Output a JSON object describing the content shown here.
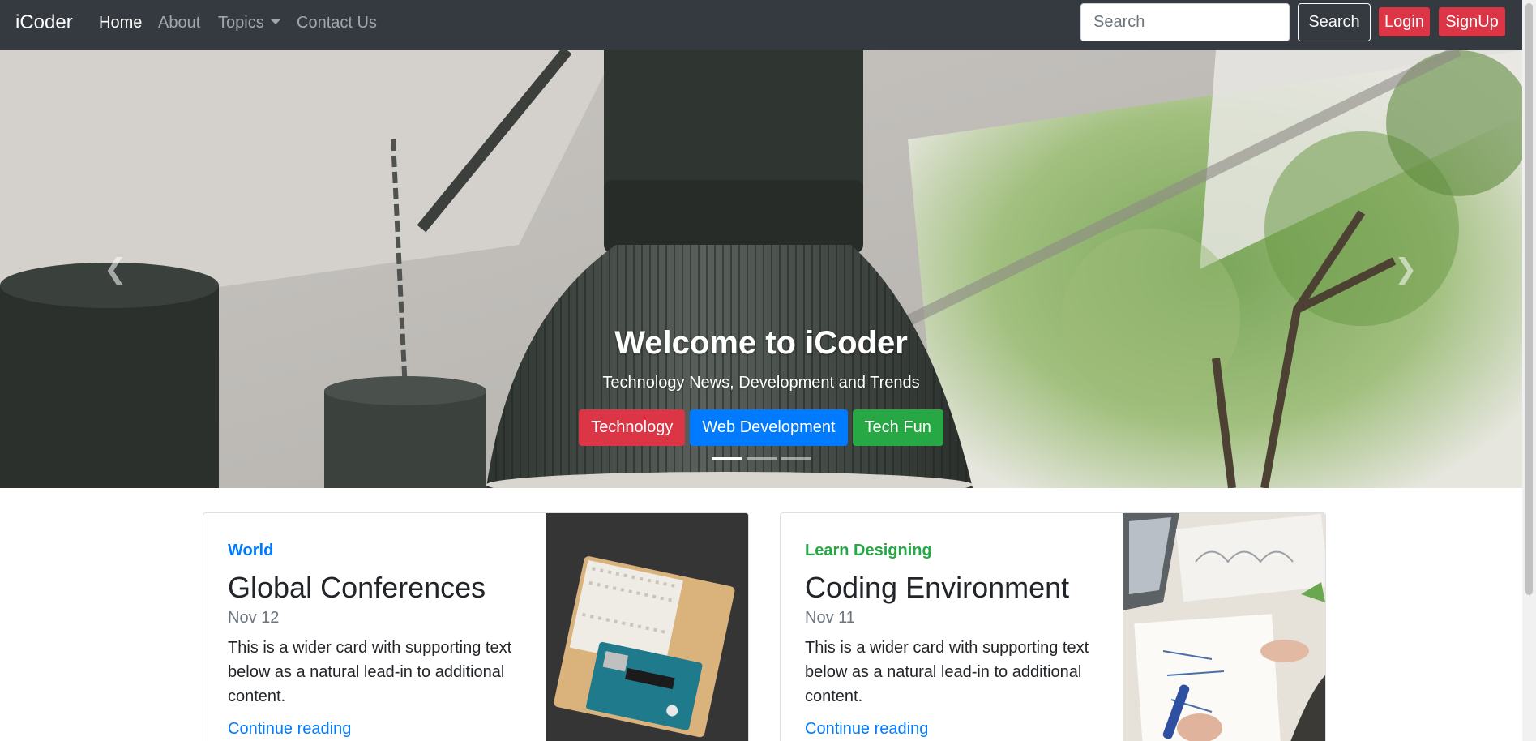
{
  "navbar": {
    "brand": "iCoder",
    "links": [
      {
        "label": "Home"
      },
      {
        "label": "About"
      },
      {
        "label": "Topics"
      },
      {
        "label": "Contact Us"
      }
    ],
    "search_placeholder": "Search",
    "search_button": "Search",
    "login_button": "Login",
    "signup_button": "SignUp"
  },
  "carousel": {
    "prev_icon": "chevron-left-icon",
    "next_icon": "chevron-right-icon",
    "title": "Welcome to iCoder",
    "subtitle": "Technology News, Development and Trends",
    "buttons": [
      {
        "label": "Technology",
        "color": "#dc3545"
      },
      {
        "label": "Web Development",
        "color": "#007bff"
      },
      {
        "label": "Tech Fun",
        "color": "#28a745"
      }
    ],
    "slide_count": 3,
    "active_slide": 1
  },
  "cards": [
    {
      "category": "World",
      "category_color": "#007bff",
      "title": "Global Conferences",
      "date": "Nov 12",
      "text": "This is a wider card with supporting text below as a natural lead-in to additional content.",
      "link": "Continue reading"
    },
    {
      "category": "Learn Designing",
      "category_color": "#28a745",
      "title": "Coding Environment",
      "date": "Nov 11",
      "text": "This is a wider card with supporting text below as a natural lead-in to additional content.",
      "link": "Continue reading"
    }
  ],
  "colors": {
    "navbar_bg": "#343a40",
    "danger": "#dc3545",
    "primary": "#007bff",
    "success": "#28a745"
  }
}
